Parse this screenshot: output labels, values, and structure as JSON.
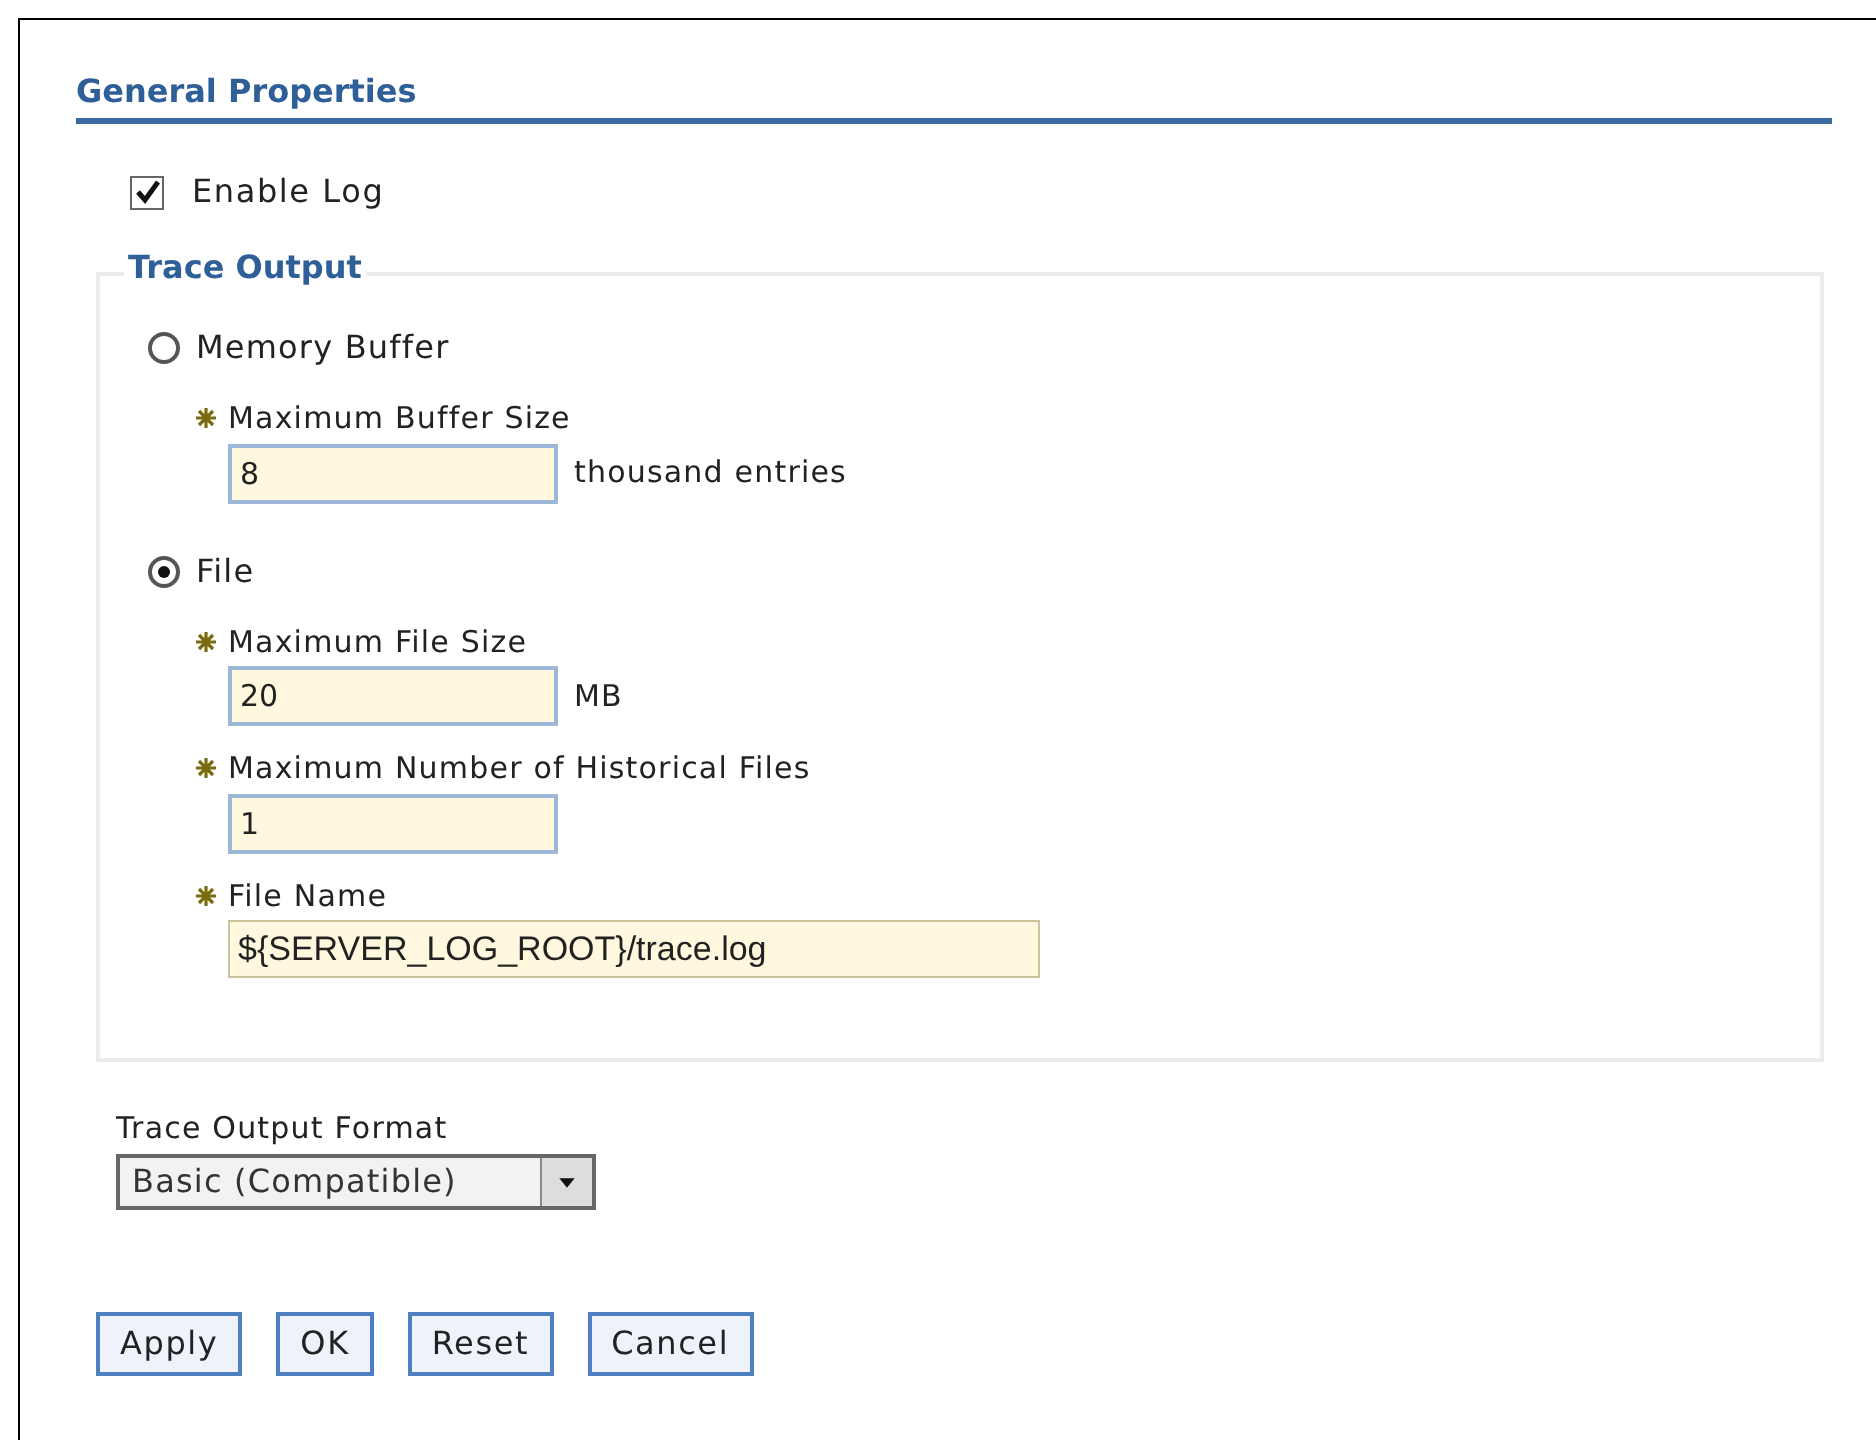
{
  "section_title": "General Properties",
  "enable_log": {
    "label": "Enable Log",
    "checked": true
  },
  "trace_output": {
    "legend": "Trace Output",
    "options": [
      {
        "label": "Memory Buffer",
        "selected": false,
        "fields": [
          {
            "label": "Maximum Buffer Size",
            "required": true,
            "kind": "short",
            "value": "8",
            "unit": "thousand entries"
          }
        ]
      },
      {
        "label": "File",
        "selected": true,
        "fields": [
          {
            "label": "Maximum File Size",
            "required": true,
            "kind": "short",
            "value": "20",
            "unit": "MB"
          },
          {
            "label": "Maximum Number of Historical Files",
            "required": true,
            "kind": "short",
            "value": "1"
          },
          {
            "label": "File Name",
            "required": true,
            "kind": "wide",
            "value": "${SERVER_LOG_ROOT}/trace.log"
          }
        ]
      }
    ]
  },
  "format": {
    "label": "Trace Output Format",
    "value": "Basic (Compatible)"
  },
  "buttons": [
    "Apply",
    "OK",
    "Reset",
    "Cancel"
  ]
}
